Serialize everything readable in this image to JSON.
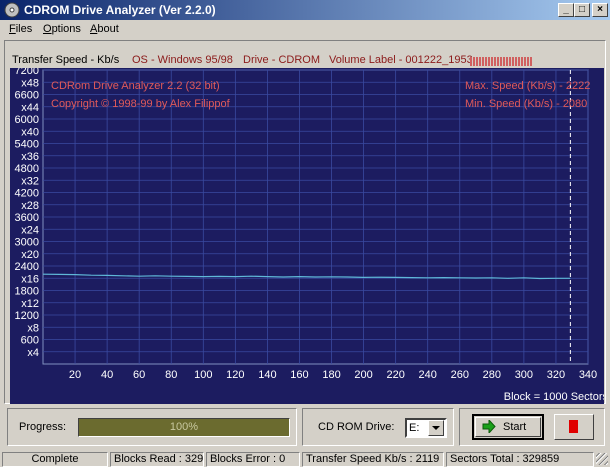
{
  "window": {
    "title": "CDROM Drive Analyzer (Ver 2.2.0)"
  },
  "menu": [
    {
      "label": "Files",
      "accel": "F",
      "rest": "iles"
    },
    {
      "label": "Options",
      "accel": "O",
      "rest": "ptions"
    },
    {
      "label": "About",
      "accel": "A",
      "rest": "bout"
    }
  ],
  "header": {
    "transfer_speed": "Transfer Speed - Kb/s",
    "os": "OS - Windows 95/98",
    "drive": "Drive - CDROM",
    "volume": "Volume Label - 001222_1953"
  },
  "overlay": {
    "app_name": "CDRom Drive Analyzer 2.2 (32 bit)",
    "copyright": "Copyright © 1998-99 by Alex Filippof",
    "max_speed": "Max. Speed (Kb/s) - 2222",
    "min_speed": "Min.  Speed (Kb/s) - 2080"
  },
  "chart_data": {
    "type": "line",
    "title": "",
    "xlabel": "Block = 1000 Sectors",
    "ylabel": "Transfer Speed - Kb/s",
    "xlim": [
      0,
      340
    ],
    "ylim": [
      0,
      7200
    ],
    "x_ticks": [
      20,
      40,
      60,
      80,
      100,
      120,
      140,
      160,
      180,
      200,
      220,
      240,
      260,
      280,
      300,
      320,
      340
    ],
    "y_ticks_left": [
      {
        "v": 7200,
        "label": "7200"
      },
      {
        "v": 6900,
        "label": "x48"
      },
      {
        "v": 6600,
        "label": "6600"
      },
      {
        "v": 6300,
        "label": "x44"
      },
      {
        "v": 6000,
        "label": "6000"
      },
      {
        "v": 5700,
        "label": "x40"
      },
      {
        "v": 5400,
        "label": "5400"
      },
      {
        "v": 5100,
        "label": "x36"
      },
      {
        "v": 4800,
        "label": "4800"
      },
      {
        "v": 4500,
        "label": "x32"
      },
      {
        "v": 4200,
        "label": "4200"
      },
      {
        "v": 3900,
        "label": "x28"
      },
      {
        "v": 3600,
        "label": "3600"
      },
      {
        "v": 3300,
        "label": "x24"
      },
      {
        "v": 3000,
        "label": "3000"
      },
      {
        "v": 2700,
        "label": "x20"
      },
      {
        "v": 2400,
        "label": "2400"
      },
      {
        "v": 2100,
        "label": "x16"
      },
      {
        "v": 1800,
        "label": "1800"
      },
      {
        "v": 1500,
        "label": "x12"
      },
      {
        "v": 1200,
        "label": "1200"
      },
      {
        "v": 900,
        "label": "x8"
      },
      {
        "v": 600,
        "label": "600"
      },
      {
        "v": 300,
        "label": "x4"
      }
    ],
    "grid": true,
    "marker_x": 329,
    "series": [
      {
        "color": "#5fb8d8",
        "x": [
          0,
          10,
          20,
          30,
          40,
          50,
          60,
          70,
          80,
          90,
          100,
          110,
          120,
          130,
          140,
          150,
          160,
          170,
          180,
          190,
          200,
          210,
          220,
          230,
          240,
          250,
          260,
          270,
          280,
          290,
          300,
          310,
          320,
          329
        ],
        "values": [
          2200,
          2195,
          2190,
          2175,
          2170,
          2160,
          2150,
          2160,
          2150,
          2145,
          2140,
          2145,
          2140,
          2150,
          2140,
          2130,
          2140,
          2130,
          2135,
          2130,
          2120,
          2125,
          2120,
          2115,
          2110,
          2115,
          2110,
          2105,
          2110,
          2100,
          2110,
          2095,
          2100,
          2100
        ]
      }
    ]
  },
  "controls": {
    "progress_label": "Progress:",
    "progress_value": 1.0,
    "progress_text": "100%",
    "drive_label": "CD ROM Drive:",
    "drive_value": "E:",
    "start_label": "Start"
  },
  "status": {
    "state": "Complete",
    "blocks_read": "Blocks Read : 329",
    "blocks_error": "Blocks Error : 0",
    "transfer_speed": "Transfer Speed Kb/s : 2119",
    "sectors_total": "Sectors Total : 329859"
  },
  "colors": {
    "plot_bg": "#1c1c60",
    "grid": "#3a4aa0",
    "overlay_text": "#e05a5a",
    "line": "#5fb8d8"
  }
}
